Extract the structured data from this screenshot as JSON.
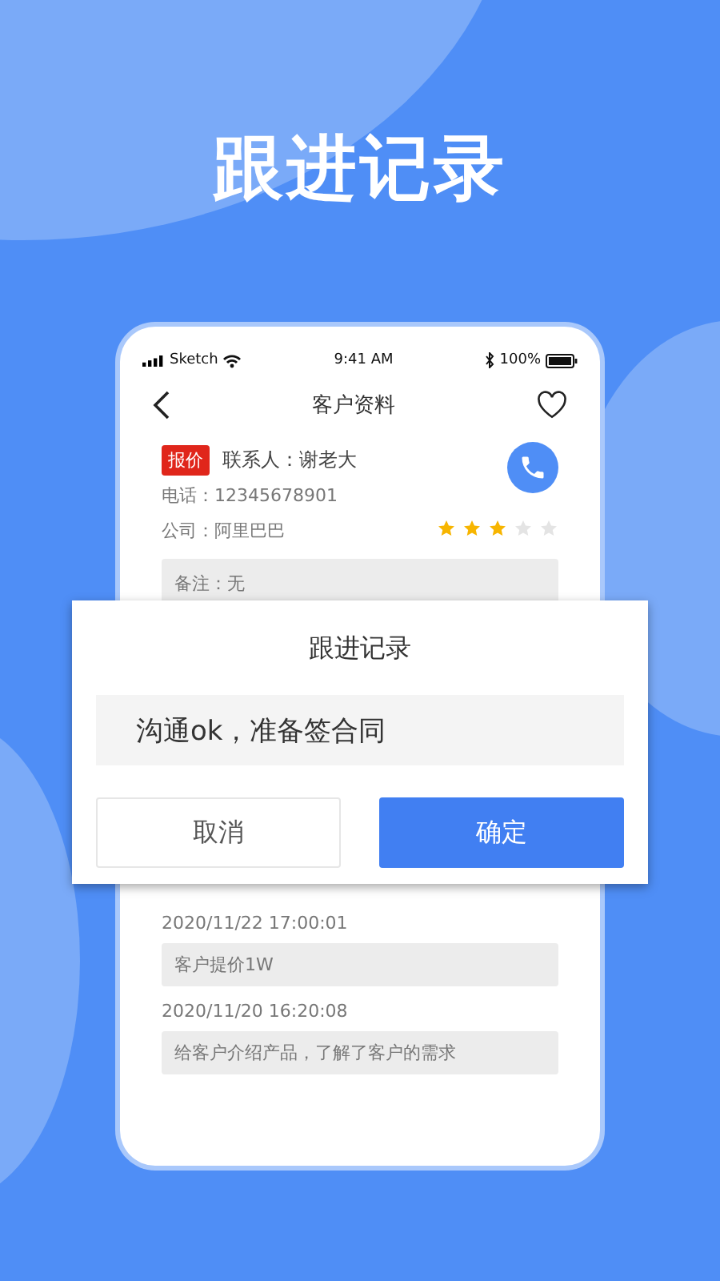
{
  "headline": "跟进记录",
  "status_bar": {
    "carrier": "Sketch",
    "time": "9:41 AM",
    "battery": "100%"
  },
  "nav": {
    "title": "客户资料"
  },
  "customer": {
    "tag": "报价",
    "contact": "联系人：谢老大",
    "phone": "电话：12345678901",
    "company": "公司：阿里巴巴",
    "stars": 3,
    "remark": "备注：无"
  },
  "records": [
    {
      "time": "2020/11/22 17:00:01",
      "note": "客户提价1W"
    },
    {
      "time": "2020/11/20 16:20:08",
      "note": "给客户介绍产品，了解了客户的需求"
    }
  ],
  "dialog": {
    "title": "跟进记录",
    "value": "沟通ok，准备签合同",
    "buttons": [
      {
        "label": "取消",
        "kind": "secondary"
      },
      {
        "label": "确定",
        "kind": "primary"
      }
    ]
  }
}
